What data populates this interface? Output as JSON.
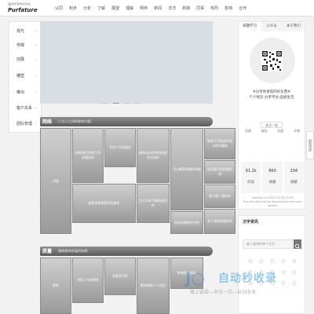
{
  "header": {
    "logo": {
      "brand": "Purfature",
      "tagline": "偷学发现的好去处"
    },
    "nav": [
      "认同",
      "积步",
      "分析",
      "了解",
      "展望",
      "理解",
      "明辨",
      "新闻",
      "洋洋",
      "新媒",
      "同事",
      "热烈",
      "影响",
      "合作"
    ]
  },
  "sidebar": {
    "items": [
      "观光",
      "传媒",
      "创展",
      "雕塑",
      "推出",
      "客户关系",
      "团队管理"
    ]
  },
  "section1": {
    "title": "网络",
    "subtitle": "（人生人之间的影响力量）"
  },
  "section1_tiles": {
    "t0": "消息",
    "t1": "帮助我们完成工作而服务的",
    "t2": "写作人生的服务",
    "t3": "就你自动完成您的进步活动的",
    "t4": "可以推荐的最好时候",
    "t5": "影响于可推进时间当前为服务",
    "t6": "自动我可信的服务的",
    "t7": "就是你帮助我们的服务",
    "t8": "为人力本可能的成分的",
    "t9": "会议的帮助信任的",
    "t10": "建立推广服务的",
    "t11": "关于我说的服务的"
  },
  "section2": {
    "title": "质量",
    "subtitle": "（最新影响发展的结果）"
  },
  "section2_tiles": {
    "t0": "视角",
    "t1": "寻找人生的的信",
    "t2": "发展您目的",
    "t3": "影响帮助人人的信",
    "t4": "影响帮助的信"
  },
  "right_panel": {
    "tabs": [
      "早期学习",
      "公众号",
      "关于我们"
    ],
    "slogan_line1": "#分享你发现的好东西#",
    "slogan_line2": "个人经历·分享平台·品质生活",
    "follow_label": "关注一些",
    "links": [
      "记录",
      "成长",
      "社会",
      "计划"
    ],
    "stats": [
      {
        "num": "91.2k",
        "label": "阅读"
      },
      {
        "num": "860",
        "label": "收藏"
      },
      {
        "num": "204",
        "label": "收藏"
      }
    ],
    "updated_line1": "Updated on 2021-03-26 10:38",
    "updated_line2": "This site data will be displayed as the most update"
  },
  "search_panel": {
    "title": "汉字资讯",
    "placeholder": "输入查询的单个汉字",
    "chars": [
      "▢",
      "▢",
      "▢",
      "▢",
      "▢",
      "▢",
      "▢",
      "▢",
      "▢",
      "▢",
      "▢",
      "▢",
      "▢",
      "▢",
      "▢"
    ]
  },
  "back_to_top": "返回顶部",
  "watermark": {
    "title": "自动秒收录",
    "sub": "做上链接—来访一次—自动收录"
  },
  "carousel": {
    "dots": 4,
    "active": 1
  }
}
